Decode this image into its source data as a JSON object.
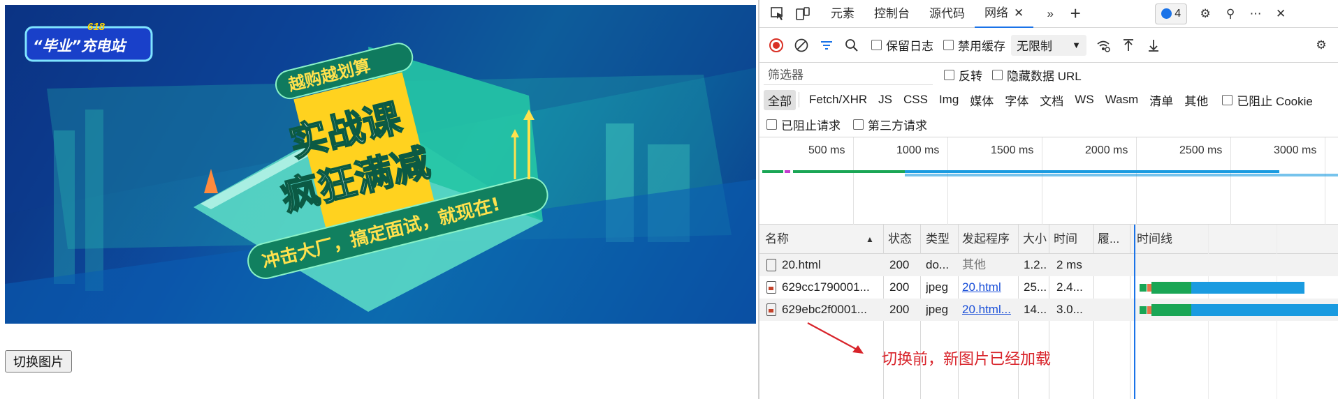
{
  "page": {
    "banner": {
      "logo_number": "618",
      "logo_text": "“毕业”充电站",
      "headline_top": "越购越划算",
      "headline_main_1": "实战课",
      "headline_main_2": "疯狂满减",
      "slogan": "冲击大厂，搞定面试，就现在!"
    },
    "switch_button": "切换图片"
  },
  "devtools": {
    "tabs": [
      "元素",
      "控制台",
      "源代码",
      "网络"
    ],
    "active_tab": "网络",
    "message_count": "4",
    "toolbar": {
      "preserve_log": "保留日志",
      "disable_cache": "禁用缓存",
      "throttle": "无限制"
    },
    "filter": {
      "placeholder": "筛选器",
      "invert": "反转",
      "hide_data_urls": "隐藏数据 URL"
    },
    "types": [
      "全部",
      "Fetch/XHR",
      "JS",
      "CSS",
      "Img",
      "媒体",
      "字体",
      "文档",
      "WS",
      "Wasm",
      "清单",
      "其他"
    ],
    "active_type": "全部",
    "blocked_cookies": "已阻止 Cookie",
    "blocked_requests": "已阻止请求",
    "third_party": "第三方请求",
    "overview_ticks": [
      "500 ms",
      "1000 ms",
      "1500 ms",
      "2000 ms",
      "2500 ms",
      "3000 ms"
    ],
    "columns": [
      "名称",
      "状态",
      "类型",
      "发起程序",
      "大小",
      "时间",
      "履...",
      "时间线"
    ],
    "rows": [
      {
        "name": "20.html",
        "status": "200",
        "type": "do...",
        "initiator": "其他",
        "size": "1.2...",
        "time": "2 ms"
      },
      {
        "name": "629cc1790001...",
        "status": "200",
        "type": "jpeg",
        "initiator": "20.html",
        "size": "25...",
        "time": "2.4..."
      },
      {
        "name": "629ebc2f0001...",
        "status": "200",
        "type": "jpeg",
        "initiator": "20.html...",
        "size": "14...",
        "time": "3.0..."
      }
    ],
    "annotation": "切换前，新图片已经加载"
  },
  "colors": {
    "accent": "#1a73e8",
    "record_red": "#d93025",
    "annotation_red": "#d8232a",
    "waterfall_green": "#1aa655",
    "waterfall_blue": "#1a9be0"
  }
}
